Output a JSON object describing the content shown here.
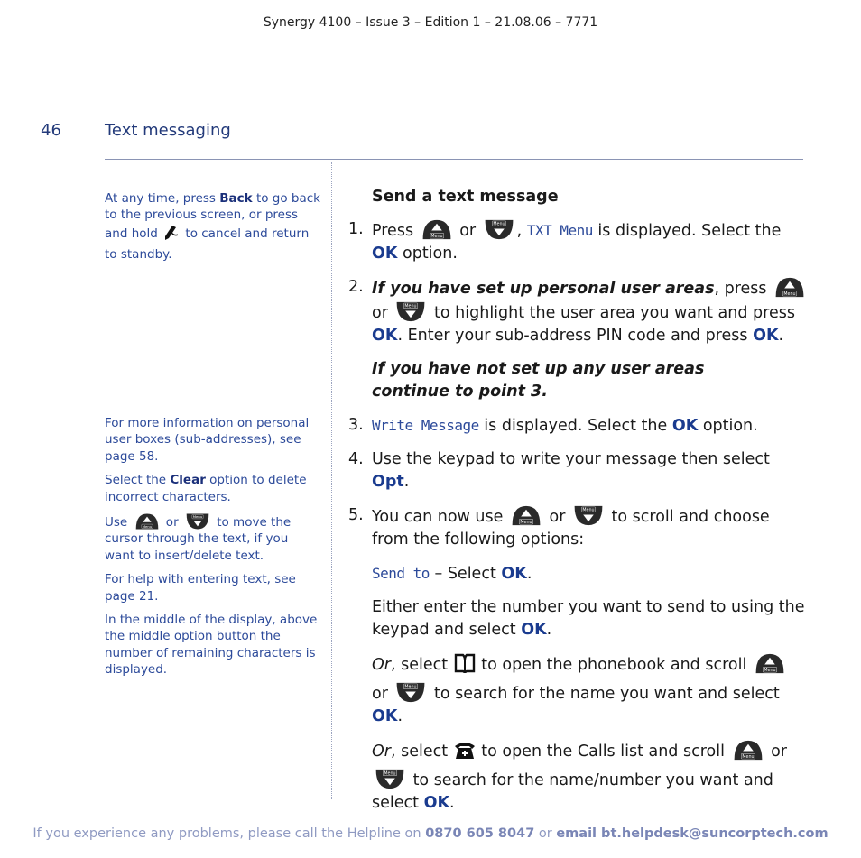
{
  "header": {
    "doc_id": "Synergy 4100 – Issue 3 – Edition 1 – 21.08.06 – 7771"
  },
  "page": {
    "number": "46",
    "section": "Text messaging"
  },
  "sidebar": {
    "note1": {
      "a": "At any time, press ",
      "b": "Back",
      "c": " to go back to the previous screen, or press and hold ",
      "d": " to cancel and return to standby."
    },
    "note2": "For more information on personal user boxes (sub-addresses), see page 58.",
    "note3": {
      "a": "Select the ",
      "b": "Clear",
      "c": " option to delete incorrect characters."
    },
    "note4": {
      "a": "Use ",
      "b": " or ",
      "c": " to move the cursor through the text, if you want to insert/delete text."
    },
    "note5": "For help with entering text, see page 21.",
    "note6": "In the middle of the display, above the middle option button the number of remaining characters is displayed."
  },
  "main": {
    "title": "Send a text message",
    "step1": {
      "n": "1.",
      "a": "Press ",
      "b": " or ",
      "c": ", ",
      "lcd": "TXT Menu",
      "d": " is displayed. Select the ",
      "ok": "OK",
      "e": " option."
    },
    "step2": {
      "n": "2.",
      "bi": "If you have set up personal user areas",
      "a": ", press ",
      "b": " or ",
      "c": " to highlight the user area you want and press ",
      "ok": "OK",
      "d": ". Enter your sub-address PIN code and press ",
      "ok2": "OK",
      "e": "."
    },
    "note": "If you have not set up any user areas continue to point 3.",
    "step3": {
      "n": "3.",
      "lcd": "Write Message",
      "a": " is displayed. Select the ",
      "ok": "OK",
      "b": " option."
    },
    "step4": {
      "n": "4.",
      "a": "Use the keypad to write your message then select ",
      "ok": "Opt",
      "b": "."
    },
    "step5": {
      "n": "5.",
      "a": "You can now use ",
      "b": " or ",
      "c": " to scroll and choose from the following options:"
    },
    "sendto": {
      "lcd": "Send to",
      "a": " – Select ",
      "ok": "OK",
      "b": "."
    },
    "either": {
      "a": "Either enter the number you want to send to using the keypad and select ",
      "ok": "OK",
      "b": "."
    },
    "or1": {
      "i": "Or",
      "a": ", select ",
      "b": " to open the phonebook and scroll ",
      "c": " or ",
      "d": " to search for the name you want and select ",
      "ok": "OK",
      "e": "."
    },
    "or2": {
      "i": "Or",
      "a": ", select ",
      "b": " to open the Calls list and scroll ",
      "c": " or ",
      "d": " to search for the name/number you want and select ",
      "ok": "OK",
      "e": "."
    }
  },
  "icons": {
    "up": "menu-up-button-icon",
    "down": "menu-down-button-icon",
    "end": "end-call-icon",
    "phonebook": "phonebook-icon",
    "calls": "calls-list-icon",
    "menu_label": "Menu"
  },
  "footer": {
    "a": "If you experience any problems, please call the Helpline on ",
    "phone": "0870 605 8047",
    "b": " or ",
    "email": "email bt.helpdesk@suncorptech.com"
  },
  "colors": {
    "accent": "#1a3b8f",
    "side_text": "#2c4a9a",
    "footer": "#8f9ac2"
  }
}
